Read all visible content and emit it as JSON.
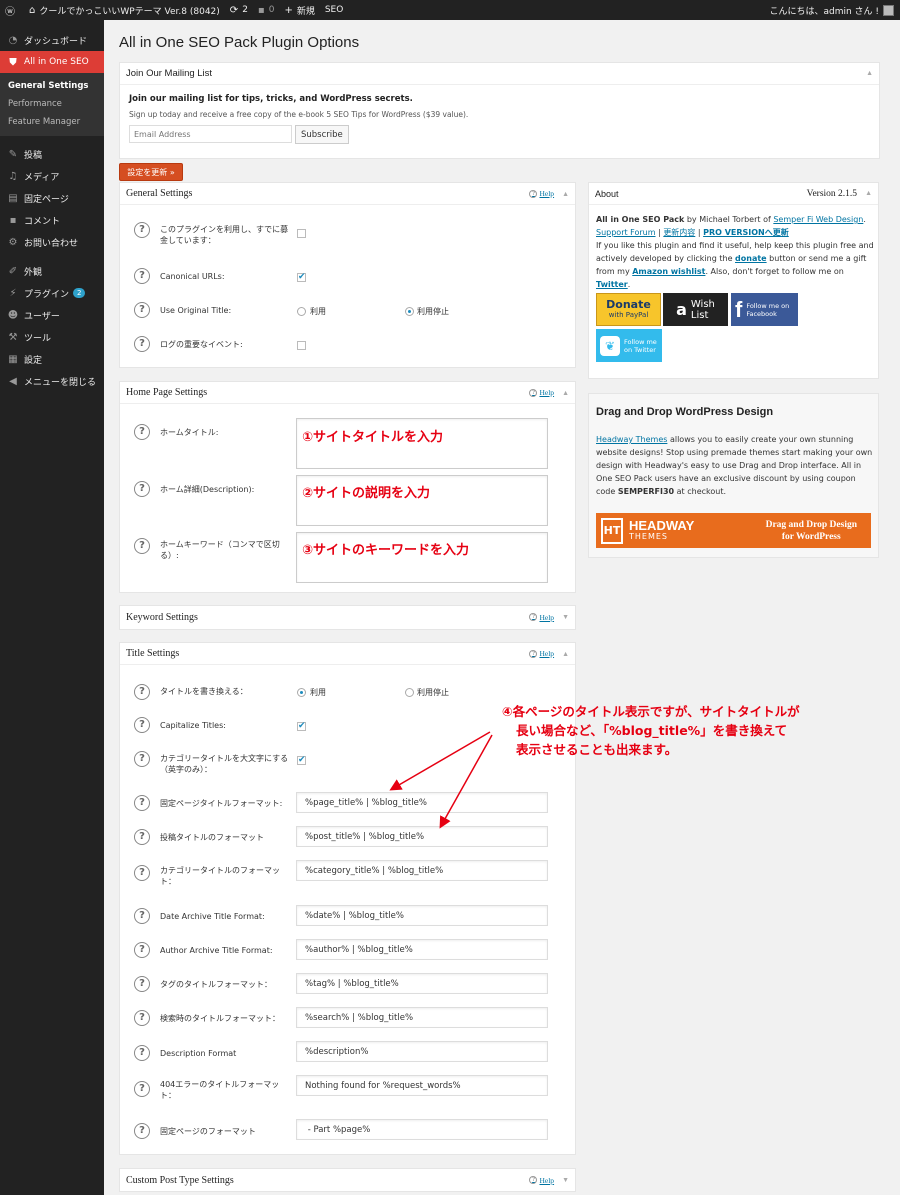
{
  "adminbar": {
    "site_name": "クールでかっこいいWPテーマ Ver.8 (8042)",
    "updates_count": "2",
    "comments_count": "0",
    "new_label": "新規",
    "seo_label": "SEO",
    "greeting": "こんにちは、admin さん !"
  },
  "sidebar": {
    "items": [
      {
        "label": "ダッシュボード",
        "icon": "dashboard-icon"
      },
      {
        "label": "All in One SEO",
        "icon": "seo-shield-icon"
      }
    ],
    "submenu": [
      "General Settings",
      "Performance",
      "Feature Manager"
    ],
    "items2": [
      {
        "label": "投稿",
        "icon": "pin-icon"
      },
      {
        "label": "メディア",
        "icon": "media-icon"
      },
      {
        "label": "固定ページ",
        "icon": "page-icon"
      },
      {
        "label": "コメント",
        "icon": "comment-icon"
      },
      {
        "label": "お問い合わせ",
        "icon": "gear-icon"
      }
    ],
    "items3": [
      {
        "label": "外観",
        "icon": "brush-icon"
      },
      {
        "label": "プラグイン",
        "icon": "plugin-icon",
        "badge": "2"
      },
      {
        "label": "ユーザー",
        "icon": "user-icon"
      },
      {
        "label": "ツール",
        "icon": "wrench-icon"
      },
      {
        "label": "設定",
        "icon": "settings-icon"
      },
      {
        "label": "メニューを閉じる",
        "icon": "collapse-icon"
      }
    ]
  },
  "page_title": "All in One SEO Pack Plugin Options",
  "mailing": {
    "header": "Join Our Mailing List",
    "heading": "Join our mailing list for tips, tricks, and WordPress secrets.",
    "sub": "Sign up today and receive a free copy of the e-book 5 SEO Tips for WordPress ($39 value).",
    "email_placeholder": "Email Address",
    "subscribe": "Subscribe"
  },
  "update_button": "設定を更新 »",
  "help_label": "Help",
  "general": {
    "header": "General Settings",
    "donated": "このプラグインを利用し、すでに募金しています：",
    "canonical": "Canonical URLs:",
    "original_title": "Use Original Title:",
    "opt_use": "利用",
    "opt_stop": "利用停止",
    "log": "ログの重要なイベント:"
  },
  "home": {
    "header": "Home Page Settings",
    "title_label": "ホームタイトル:",
    "desc_label": "ホーム詳細(Description):",
    "kw_label": "ホームキーワード（コンマで区切る）:",
    "note1": "①サイトタイトルを入力",
    "note2": "②サイトの説明を入力",
    "note3": "③サイトのキーワードを入力"
  },
  "keyword_header": "Keyword Settings",
  "title_settings": {
    "header": "Title Settings",
    "rewrite": "タイトルを書き換える：",
    "opt_use": "利用",
    "opt_stop": "利用停止",
    "capitalize": "Capitalize Titles:",
    "cat_caps": "カテゴリータイトルを大文字にする（英字のみ）：",
    "page_fmt_label": "固定ページタイトルフォーマット:",
    "page_fmt": "%page_title% | %blog_title%",
    "post_fmt_label": "投稿タイトルのフォーマット",
    "post_fmt": "%post_title% | %blog_title%",
    "cat_fmt_label": "カテゴリータイトルのフォーマット：",
    "cat_fmt": "%category_title% | %blog_title%",
    "date_fmt_label": "Date Archive Title Format:",
    "date_fmt": "%date% | %blog_title%",
    "author_fmt_label": "Author Archive Title Format:",
    "author_fmt": "%author% | %blog_title%",
    "tag_fmt_label": "タグのタイトルフォーマット：",
    "tag_fmt": "%tag% | %blog_title%",
    "search_fmt_label": "検索時のタイトルフォーマット：",
    "search_fmt": "%search% | %blog_title%",
    "desc_fmt_label": "Description Format",
    "desc_fmt": "%description%",
    "err_fmt_label": "404エラーのタイトルフォーマット：",
    "err_fmt": "Nothing found for %request_words%",
    "paged_fmt_label": "固定ページのフォーマット",
    "paged_fmt": " - Part %page%",
    "note4_l1": "④各ページのタイトル表示ですが、サイトタイトルが",
    "note4_l2": "長い場合など、「%blog_title%」を書き換えて",
    "note4_l3": "表示させることも出来ます。"
  },
  "custom_header": "Custom Post Type Settings",
  "about": {
    "header": "About",
    "version": "Version 2.1.5",
    "plugin_name": "All in One SEO Pack",
    "by": " by Michael Torbert of ",
    "company": "Semper Fi Web Design",
    "support": "Support Forum",
    "changelog": "更新内容",
    "pro": "PRO VERSIONへ更新",
    "text1": "If you like this plugin and find it useful, help keep this plugin free and actively developed by clicking the ",
    "donate_link": "donate",
    "text2": " button or send me a gift from my ",
    "wishlist": "Amazon wishlist",
    "text3": ". Also, don't forget to follow me on ",
    "twitter": "Twitter",
    "donate_btn": "Donate",
    "paypal": "with PayPal",
    "wish1": "Wish",
    "wish2": "List",
    "fb": "Follow me on Facebook",
    "tw": "Follow me on Twitter"
  },
  "headway": {
    "title": "Drag and Drop WordPress Design",
    "link": "Headway Themes",
    "body": " allows you to easily create your own stunning website designs! Stop using premade themes start making your own design with Headway's easy to use Drag and Drop interface. All in One SEO Pack users have an exclusive discount by using coupon code ",
    "code": "SEMPERFI30",
    "tail": " at checkout.",
    "logo": "HEADWAY",
    "logo2": "THEMES",
    "tag1": "Drag and Drop Design",
    "tag2": "for WordPress"
  },
  "colors": {
    "accent": "#dd3d36",
    "link": "#0074a2",
    "note": "#e60012",
    "headway": "#e86c1d"
  }
}
